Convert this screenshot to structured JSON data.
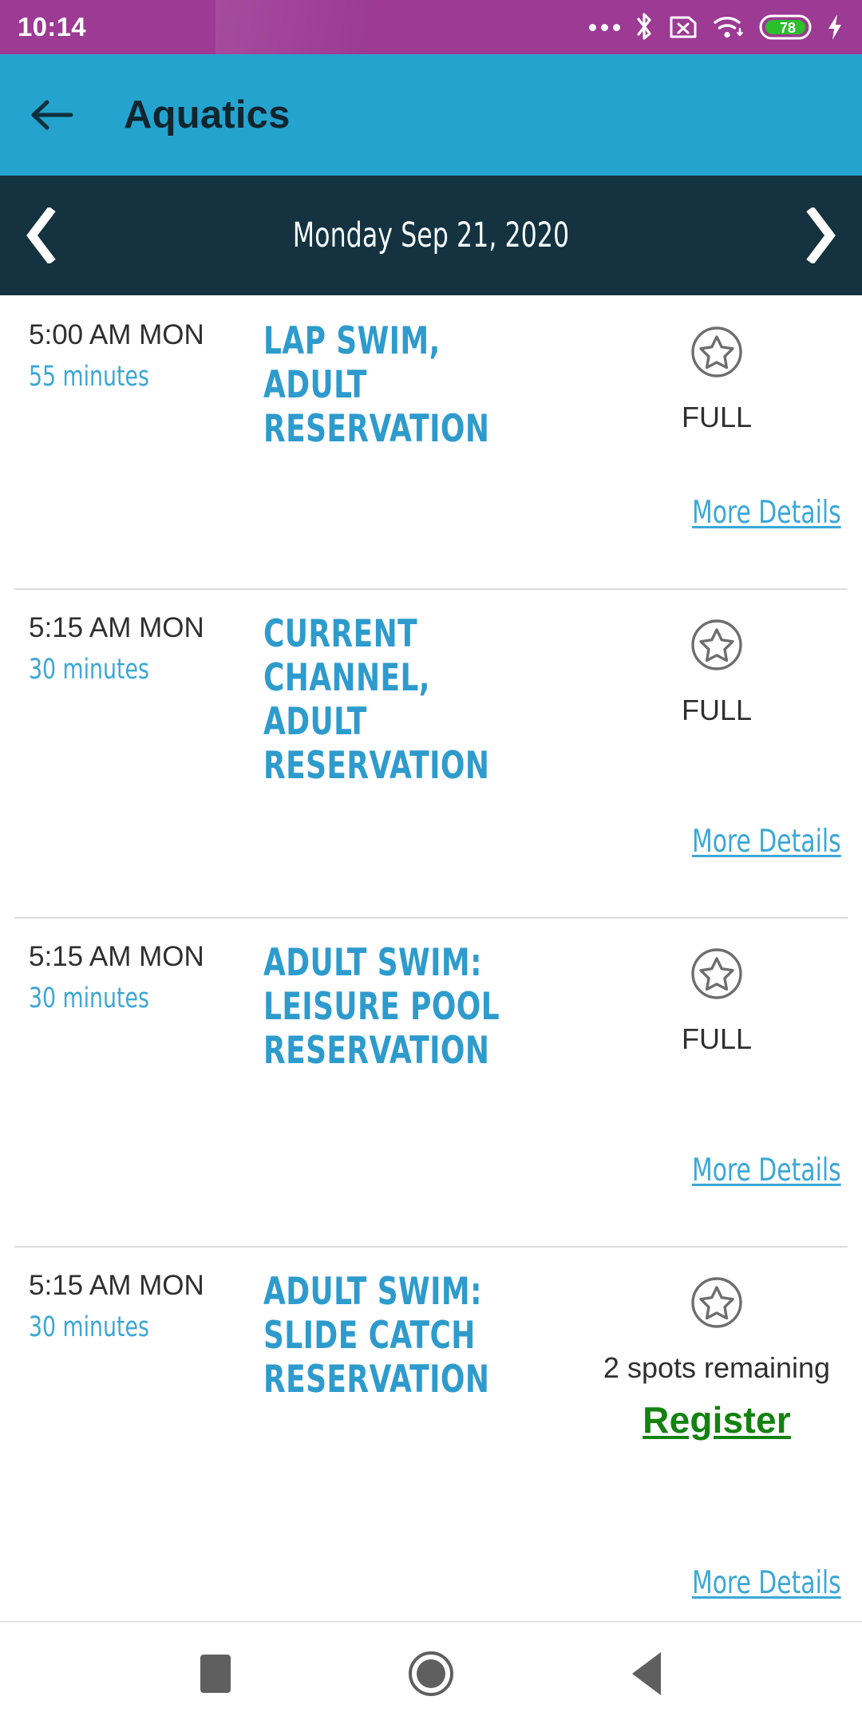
{
  "status_bar": {
    "time": "10:14",
    "battery_level": "78",
    "icons": [
      "more-dots-icon",
      "bluetooth-icon",
      "sim-card-off-icon",
      "wifi-icon",
      "battery-icon",
      "charging-bolt-icon"
    ],
    "background_color": "#9c3a94",
    "battery_fill_color": "#2bbf2b"
  },
  "app_bar": {
    "title": "Aquatics",
    "back_icon": "back-arrow-icon",
    "background_color": "#25a3cf",
    "title_color": "#10252e"
  },
  "date_bar": {
    "date": "Monday Sep 21, 2020",
    "prev_icon": "chevron-left-icon",
    "next_icon": "chevron-right-icon",
    "background_color": "#14323f"
  },
  "common": {
    "more_details_label": "More Details",
    "favorite_icon": "star-circle-icon",
    "link_color": "#3ba7d6",
    "register_color": "#13820f"
  },
  "events": [
    {
      "time": "5:00 AM MON",
      "duration": "55 minutes",
      "title": "LAP SWIM, ADULT\nRESERVATION",
      "status": "FULL",
      "action": null,
      "more_details": "More Details"
    },
    {
      "time": "5:15 AM MON",
      "duration": "30 minutes",
      "title": "CURRENT\nCHANNEL, ADULT\nRESERVATION",
      "status": "FULL",
      "action": null,
      "more_details": "More Details"
    },
    {
      "time": "5:15 AM MON",
      "duration": "30 minutes",
      "title": "ADULT SWIM:\nLEISURE POOL\nRESERVATION",
      "status": "FULL",
      "action": null,
      "more_details": "More Details"
    },
    {
      "time": "5:15 AM MON",
      "duration": "30 minutes",
      "title": "ADULT SWIM:\nSLIDE CATCH\nRESERVATION",
      "status": "2 spots\nremaining",
      "action": "Register",
      "more_details": "More Details"
    }
  ],
  "nav_bar": {
    "recents_icon": "square-recents-icon",
    "home_icon": "circle-home-icon",
    "back_icon": "triangle-back-icon"
  }
}
